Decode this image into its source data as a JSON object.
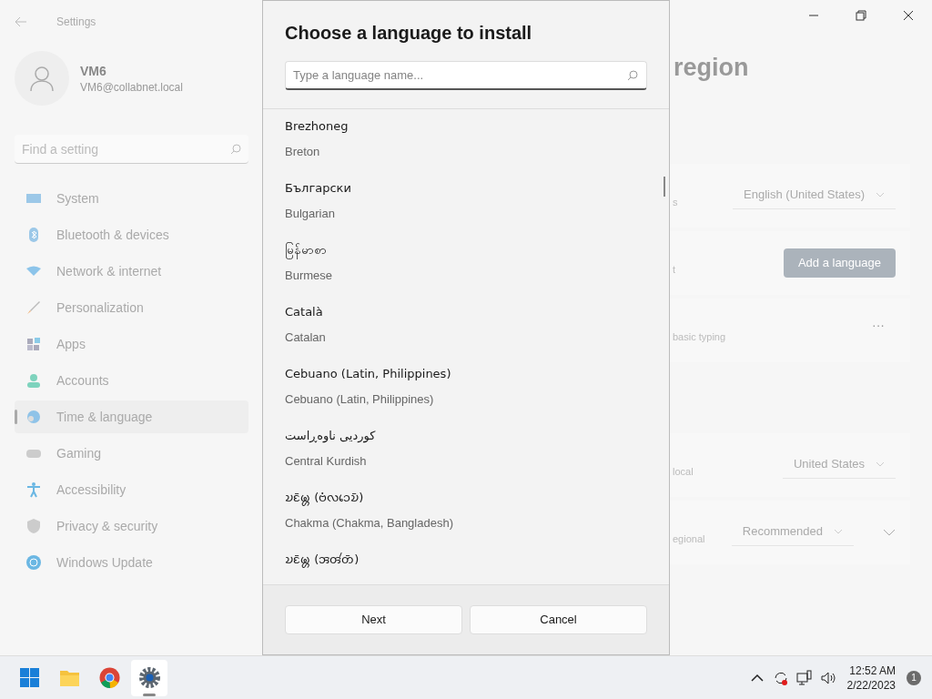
{
  "settings": {
    "title": "Settings",
    "user": {
      "name": "VM6",
      "email": "VM6@collabnet.local"
    },
    "search": {
      "placeholder": "Find a setting"
    },
    "nav": [
      {
        "label": "System",
        "selected": false
      },
      {
        "label": "Bluetooth & devices",
        "selected": false
      },
      {
        "label": "Network & internet",
        "selected": false
      },
      {
        "label": "Personalization",
        "selected": false
      },
      {
        "label": "Apps",
        "selected": false
      },
      {
        "label": "Accounts",
        "selected": false
      },
      {
        "label": "Time & language",
        "selected": true
      },
      {
        "label": "Gaming",
        "selected": false
      },
      {
        "label": "Accessibility",
        "selected": false
      },
      {
        "label": "Privacy & security",
        "selected": false
      },
      {
        "label": "Windows Update",
        "selected": false
      }
    ],
    "page_title": "region",
    "cards": [
      {
        "kind": "dropdown",
        "label": "s",
        "value": "English (United States)"
      },
      {
        "kind": "button",
        "label": "t",
        "button": "Add a language"
      },
      {
        "kind": "more",
        "label": "basic typing",
        "button": "···"
      },
      {
        "kind": "spacer"
      },
      {
        "kind": "dropdown",
        "label": "local",
        "value": "United States"
      },
      {
        "kind": "dropdown_expand",
        "label": "egional",
        "value": "Recommended"
      }
    ]
  },
  "dialog": {
    "title": "Choose a language to install",
    "search": {
      "placeholder": "Type a language name..."
    },
    "languages": [
      {
        "native": "Brezhoneg",
        "english": "Breton"
      },
      {
        "native": "Български",
        "english": "Bulgarian"
      },
      {
        "native": "မြန်မာစာ",
        "english": "Burmese"
      },
      {
        "native": "Català",
        "english": "Catalan"
      },
      {
        "native": "Cebuano (Latin, Philippines)",
        "english": "Cebuano (Latin, Philippines)"
      },
      {
        "native": "کوردیی ناوەڕاست",
        "english": "Central Kurdish"
      },
      {
        "native": "𑄌𑄋𑄴𑄟𑄳𑄦 (𑄝𑄁𑄣𑄘𑄬𑄌𑄴)",
        "english": "Chakma (Chakma, Bangladesh)"
      },
      {
        "native": "𑄌𑄋𑄴𑄟𑄳𑄦 (𑄞𑄢𑄧𑄖𑄴)"
      }
    ],
    "buttons": [
      "Next",
      "Cancel"
    ]
  },
  "taskbar": {
    "apps": [
      {
        "selected": false
      },
      {
        "selected": false
      },
      {
        "selected": false
      },
      {
        "selected": true
      }
    ],
    "time": "12:52 AM",
    "date": "2/22/2023",
    "notifications": "1"
  }
}
